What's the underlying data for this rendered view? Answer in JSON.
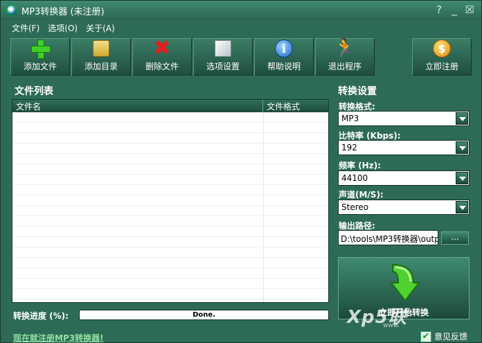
{
  "window": {
    "title": "MP3转换器 (未注册)",
    "controls": [
      "?",
      "_",
      "☒"
    ]
  },
  "menu": {
    "items": [
      "文件(F)",
      "选项(O)",
      "关于(A)"
    ]
  },
  "toolbar": {
    "buttons": [
      {
        "label": "添加文件",
        "icon": "add-file-icon"
      },
      {
        "label": "添加目录",
        "icon": "add-folder-icon"
      },
      {
        "label": "删除文件",
        "icon": "delete-icon"
      },
      {
        "label": "选项设置",
        "icon": "settings-cube-icon"
      },
      {
        "label": "帮助说明",
        "icon": "help-info-icon"
      },
      {
        "label": "退出程序",
        "icon": "exit-runner-icon"
      },
      {
        "label": "立即注册",
        "icon": "register-coin-icon"
      }
    ]
  },
  "filelist": {
    "title": "文件列表",
    "columns": [
      "文件名",
      "文件格式"
    ],
    "rows": []
  },
  "progress": {
    "label": "转换进度 (%):",
    "status": "Done."
  },
  "settings": {
    "title": "转换设置",
    "format_label": "转换格式:",
    "format_value": "MP3",
    "bitrate_label": "比特率 (Kbps):",
    "bitrate_value": "192",
    "frequency_label": "频率 (Hz):",
    "frequency_value": "44100",
    "channel_label": "声道(M/S):",
    "channel_value": "Stereo",
    "output_label": "输出路径:",
    "output_value": "D:\\tools\\MP3转换器\\outp",
    "browse_label": "...",
    "convert_label": "立即开始转换"
  },
  "status": {
    "register_link": "现在就注册MP3转换器!",
    "feedback": "意见反馈"
  },
  "watermark": {
    "text": "Xp5联",
    "sub": "www."
  }
}
